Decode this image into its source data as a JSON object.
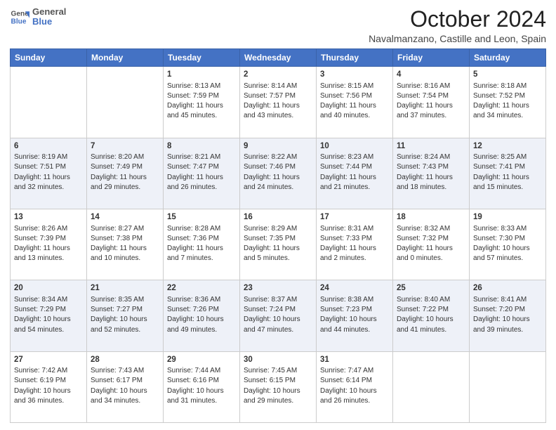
{
  "header": {
    "logo_line1": "General",
    "logo_line2": "Blue",
    "month": "October 2024",
    "location": "Navalmanzano, Castille and Leon, Spain"
  },
  "days_of_week": [
    "Sunday",
    "Monday",
    "Tuesday",
    "Wednesday",
    "Thursday",
    "Friday",
    "Saturday"
  ],
  "weeks": [
    [
      {
        "day": "",
        "info": ""
      },
      {
        "day": "",
        "info": ""
      },
      {
        "day": "1",
        "info": "Sunrise: 8:13 AM\nSunset: 7:59 PM\nDaylight: 11 hours and 45 minutes."
      },
      {
        "day": "2",
        "info": "Sunrise: 8:14 AM\nSunset: 7:57 PM\nDaylight: 11 hours and 43 minutes."
      },
      {
        "day": "3",
        "info": "Sunrise: 8:15 AM\nSunset: 7:56 PM\nDaylight: 11 hours and 40 minutes."
      },
      {
        "day": "4",
        "info": "Sunrise: 8:16 AM\nSunset: 7:54 PM\nDaylight: 11 hours and 37 minutes."
      },
      {
        "day": "5",
        "info": "Sunrise: 8:18 AM\nSunset: 7:52 PM\nDaylight: 11 hours and 34 minutes."
      }
    ],
    [
      {
        "day": "6",
        "info": "Sunrise: 8:19 AM\nSunset: 7:51 PM\nDaylight: 11 hours and 32 minutes."
      },
      {
        "day": "7",
        "info": "Sunrise: 8:20 AM\nSunset: 7:49 PM\nDaylight: 11 hours and 29 minutes."
      },
      {
        "day": "8",
        "info": "Sunrise: 8:21 AM\nSunset: 7:47 PM\nDaylight: 11 hours and 26 minutes."
      },
      {
        "day": "9",
        "info": "Sunrise: 8:22 AM\nSunset: 7:46 PM\nDaylight: 11 hours and 24 minutes."
      },
      {
        "day": "10",
        "info": "Sunrise: 8:23 AM\nSunset: 7:44 PM\nDaylight: 11 hours and 21 minutes."
      },
      {
        "day": "11",
        "info": "Sunrise: 8:24 AM\nSunset: 7:43 PM\nDaylight: 11 hours and 18 minutes."
      },
      {
        "day": "12",
        "info": "Sunrise: 8:25 AM\nSunset: 7:41 PM\nDaylight: 11 hours and 15 minutes."
      }
    ],
    [
      {
        "day": "13",
        "info": "Sunrise: 8:26 AM\nSunset: 7:39 PM\nDaylight: 11 hours and 13 minutes."
      },
      {
        "day": "14",
        "info": "Sunrise: 8:27 AM\nSunset: 7:38 PM\nDaylight: 11 hours and 10 minutes."
      },
      {
        "day": "15",
        "info": "Sunrise: 8:28 AM\nSunset: 7:36 PM\nDaylight: 11 hours and 7 minutes."
      },
      {
        "day": "16",
        "info": "Sunrise: 8:29 AM\nSunset: 7:35 PM\nDaylight: 11 hours and 5 minutes."
      },
      {
        "day": "17",
        "info": "Sunrise: 8:31 AM\nSunset: 7:33 PM\nDaylight: 11 hours and 2 minutes."
      },
      {
        "day": "18",
        "info": "Sunrise: 8:32 AM\nSunset: 7:32 PM\nDaylight: 11 hours and 0 minutes."
      },
      {
        "day": "19",
        "info": "Sunrise: 8:33 AM\nSunset: 7:30 PM\nDaylight: 10 hours and 57 minutes."
      }
    ],
    [
      {
        "day": "20",
        "info": "Sunrise: 8:34 AM\nSunset: 7:29 PM\nDaylight: 10 hours and 54 minutes."
      },
      {
        "day": "21",
        "info": "Sunrise: 8:35 AM\nSunset: 7:27 PM\nDaylight: 10 hours and 52 minutes."
      },
      {
        "day": "22",
        "info": "Sunrise: 8:36 AM\nSunset: 7:26 PM\nDaylight: 10 hours and 49 minutes."
      },
      {
        "day": "23",
        "info": "Sunrise: 8:37 AM\nSunset: 7:24 PM\nDaylight: 10 hours and 47 minutes."
      },
      {
        "day": "24",
        "info": "Sunrise: 8:38 AM\nSunset: 7:23 PM\nDaylight: 10 hours and 44 minutes."
      },
      {
        "day": "25",
        "info": "Sunrise: 8:40 AM\nSunset: 7:22 PM\nDaylight: 10 hours and 41 minutes."
      },
      {
        "day": "26",
        "info": "Sunrise: 8:41 AM\nSunset: 7:20 PM\nDaylight: 10 hours and 39 minutes."
      }
    ],
    [
      {
        "day": "27",
        "info": "Sunrise: 7:42 AM\nSunset: 6:19 PM\nDaylight: 10 hours and 36 minutes."
      },
      {
        "day": "28",
        "info": "Sunrise: 7:43 AM\nSunset: 6:17 PM\nDaylight: 10 hours and 34 minutes."
      },
      {
        "day": "29",
        "info": "Sunrise: 7:44 AM\nSunset: 6:16 PM\nDaylight: 10 hours and 31 minutes."
      },
      {
        "day": "30",
        "info": "Sunrise: 7:45 AM\nSunset: 6:15 PM\nDaylight: 10 hours and 29 minutes."
      },
      {
        "day": "31",
        "info": "Sunrise: 7:47 AM\nSunset: 6:14 PM\nDaylight: 10 hours and 26 minutes."
      },
      {
        "day": "",
        "info": ""
      },
      {
        "day": "",
        "info": ""
      }
    ]
  ]
}
